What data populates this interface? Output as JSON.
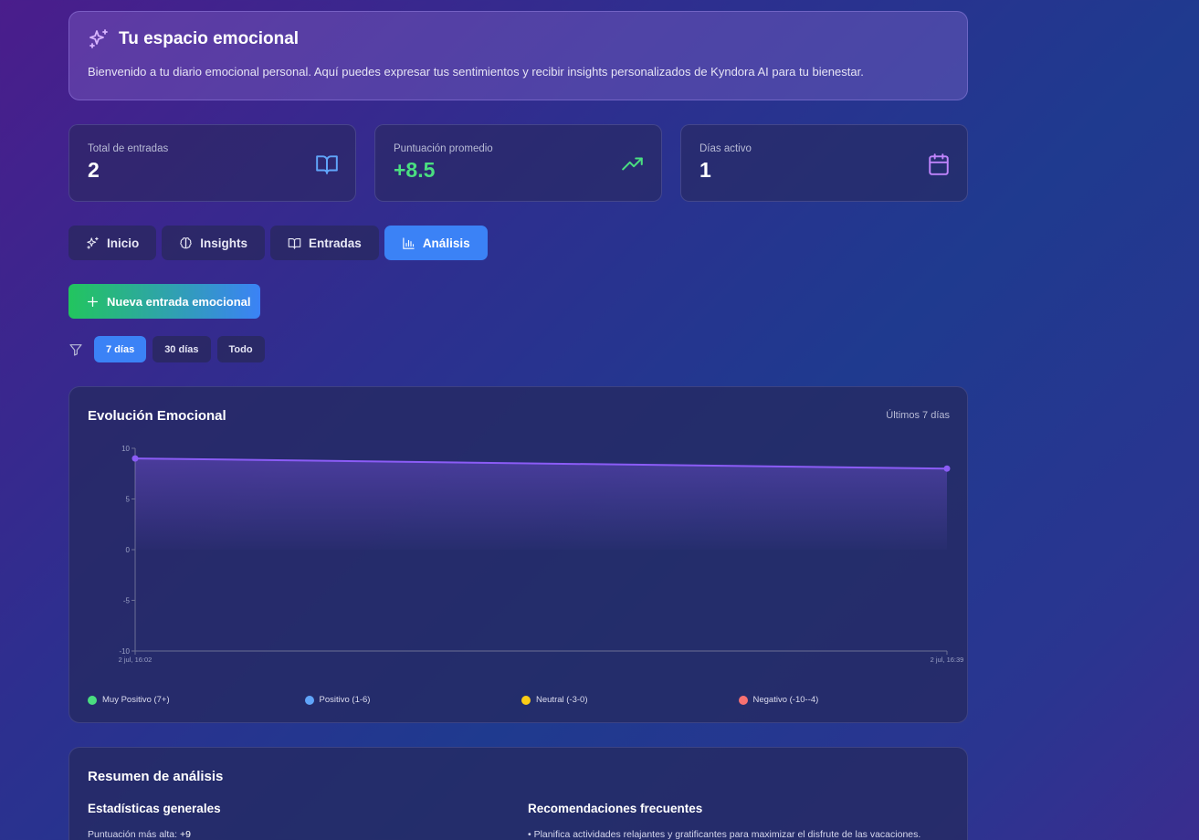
{
  "hero": {
    "title": "Tu espacio emocional",
    "text": "Bienvenido a tu diario emocional personal. Aquí puedes expresar tus sentimientos y recibir insights personalizados de Kyndora AI para tu bienestar."
  },
  "stats": [
    {
      "label": "Total de entradas",
      "value": "2",
      "icon": "book-open-icon",
      "value_color": "#ffffff",
      "icon_color": "#60a5fa"
    },
    {
      "label": "Puntuación promedio",
      "value": "+8.5",
      "icon": "trending-up-icon",
      "value_color": "#4ade80",
      "icon_color": "#4ade80"
    },
    {
      "label": "Días activo",
      "value": "1",
      "icon": "calendar-icon",
      "value_color": "#ffffff",
      "icon_color": "#c084fc"
    }
  ],
  "tabs": [
    {
      "label": "Inicio",
      "icon": "sparkles-icon",
      "active": false
    },
    {
      "label": "Insights",
      "icon": "brain-icon",
      "active": false
    },
    {
      "label": "Entradas",
      "icon": "book-open-icon",
      "active": false
    },
    {
      "label": "Análisis",
      "icon": "bar-chart-icon",
      "active": true
    }
  ],
  "new_entry_label": "Nueva entrada emocional",
  "filters": [
    {
      "label": "7 días",
      "active": true
    },
    {
      "label": "30 días",
      "active": false
    },
    {
      "label": "Todo",
      "active": false
    }
  ],
  "chart_card": {
    "title": "Evolución Emocional",
    "range_label": "Últimos 7 días"
  },
  "chart_data": {
    "type": "area",
    "x": [
      "2 jul, 16:02",
      "2 jul, 16:39"
    ],
    "series": [
      {
        "values": [
          9,
          8
        ],
        "color": "#8b5cf6"
      }
    ],
    "ylim": [
      -10,
      10
    ],
    "yticks": [
      10,
      5,
      0,
      -5,
      -10
    ],
    "grid": false,
    "legend": [
      {
        "label": "Muy Positivo (7+)",
        "color": "#4ade80"
      },
      {
        "label": "Positivo (1-6)",
        "color": "#60a5fa"
      },
      {
        "label": "Neutral (-3-0)",
        "color": "#facc15"
      },
      {
        "label": "Negativo (-10--4)",
        "color": "#f87171"
      }
    ]
  },
  "summary": {
    "title": "Resumen de análisis",
    "stats_title": "Estadísticas generales",
    "stats_line_label": "Puntuación más alta:",
    "stats_line_value": "+9",
    "recs_title": "Recomendaciones frecuentes",
    "recs_line": "• Planifica actividades relajantes y gratificantes para maximizar el disfrute de las vacaciones."
  }
}
